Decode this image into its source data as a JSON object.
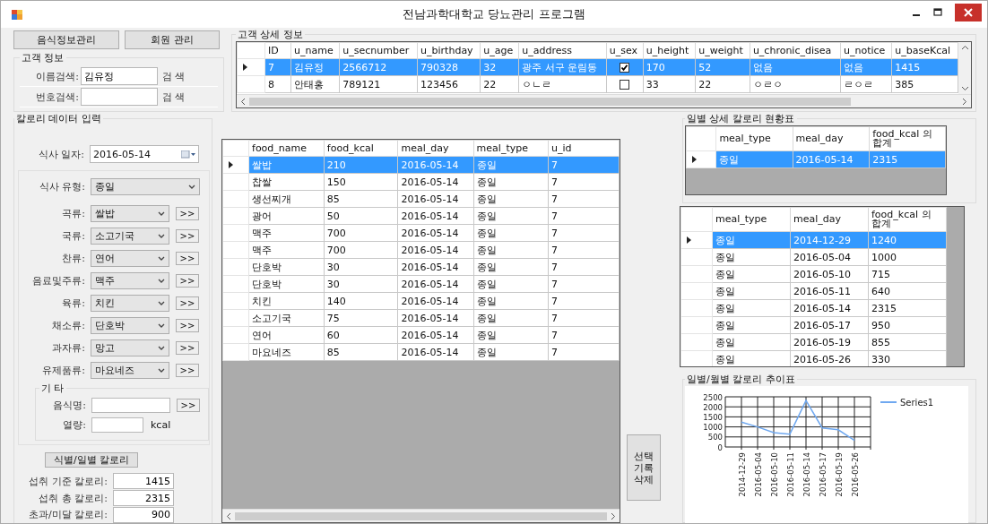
{
  "window": {
    "title": "전남과학대학교 당뇨관리 프로그램"
  },
  "top_buttons": [
    "음식정보관리",
    "회원 관리"
  ],
  "customer_info": {
    "title": "고객 정보",
    "searches": [
      {
        "label": "이름검색:",
        "value": "김유정",
        "button": "검 색"
      },
      {
        "label": "번호검색:",
        "button": "검 색"
      }
    ]
  },
  "customer_detail": {
    "title": "고객 상세 정보",
    "columns": [
      "ID",
      "u_name",
      "u_secnumber",
      "u_birthday",
      "u_age",
      "u_address",
      "u_sex",
      "u_height",
      "u_weight",
      "u_chronic_disea",
      "u_notice",
      "u_baseKcal"
    ],
    "rows": [
      {
        "selected": true,
        "cells": [
          "7",
          "김유정",
          "2566712",
          "790328",
          "32",
          "광주 서구 운림동",
          {
            "checked": true
          },
          "170",
          "52",
          "없음",
          "없음",
          "1415"
        ]
      },
      {
        "selected": false,
        "cells": [
          "8",
          "안태홍",
          "789121",
          "123456",
          "22",
          "ㅇㄴㄹ",
          {
            "checked": false
          },
          "33",
          "22",
          "ㅇㄹㅇ",
          "ㄹㅇㄹ",
          "385"
        ]
      }
    ]
  },
  "calorie_input": {
    "title": "칼로리 데이터 입력",
    "date": {
      "label": "식사 일자:",
      "value": "2016-05-14"
    },
    "meal_type": {
      "label": "식사 유형:",
      "value": "종일"
    },
    "categories": [
      {
        "label": "곡류:",
        "value": "쌀밥",
        "button": ">>"
      },
      {
        "label": "국류:",
        "value": "소고기국",
        "button": ">>"
      },
      {
        "label": "찬류:",
        "value": "연어",
        "button": ">>"
      },
      {
        "label": "음료및주류:",
        "value": "맥주",
        "button": ">>"
      },
      {
        "label": "육류:",
        "value": "치킨",
        "button": ">>"
      },
      {
        "label": "채소류:",
        "value": "단호박",
        "button": ">>"
      },
      {
        "label": "과자류:",
        "value": "망고",
        "button": ">>"
      },
      {
        "label": "유제품류:",
        "value": "마요네즈",
        "button": ">>"
      }
    ],
    "other": {
      "title": "기 타",
      "name_label": "음식명:",
      "name_button": ">>",
      "kcal_label": "열량:",
      "unit": "kcal"
    },
    "calc_button": "식별/일별 칼로리",
    "summary": [
      {
        "label": "섭취 기준 칼로리:",
        "value": "1415"
      },
      {
        "label": "섭취 총 칼로리:",
        "value": "2315"
      },
      {
        "label": "초과/미달 칼로리:",
        "value": "900"
      }
    ]
  },
  "food_table": {
    "columns": [
      "food_name",
      "food_kcal",
      "meal_day",
      "meal_type",
      "u_id"
    ],
    "rows": [
      {
        "selected": true,
        "cells": [
          "쌀밥",
          "210",
          "2016-05-14",
          "종일",
          "7"
        ]
      },
      {
        "selected": false,
        "cells": [
          "찹쌀",
          "150",
          "2016-05-14",
          "종일",
          "7"
        ]
      },
      {
        "selected": false,
        "cells": [
          "생선찌개",
          "85",
          "2016-05-14",
          "종일",
          "7"
        ]
      },
      {
        "selected": false,
        "cells": [
          "광어",
          "50",
          "2016-05-14",
          "종일",
          "7"
        ]
      },
      {
        "selected": false,
        "cells": [
          "맥주",
          "700",
          "2016-05-14",
          "종일",
          "7"
        ]
      },
      {
        "selected": false,
        "cells": [
          "맥주",
          "700",
          "2016-05-14",
          "종일",
          "7"
        ]
      },
      {
        "selected": false,
        "cells": [
          "단호박",
          "30",
          "2016-05-14",
          "종일",
          "7"
        ]
      },
      {
        "selected": false,
        "cells": [
          "단호박",
          "30",
          "2016-05-14",
          "종일",
          "7"
        ]
      },
      {
        "selected": false,
        "cells": [
          "치킨",
          "140",
          "2016-05-14",
          "종일",
          "7"
        ]
      },
      {
        "selected": false,
        "cells": [
          "소고기국",
          "75",
          "2016-05-14",
          "종일",
          "7"
        ]
      },
      {
        "selected": false,
        "cells": [
          "연어",
          "60",
          "2016-05-14",
          "종일",
          "7"
        ]
      },
      {
        "selected": false,
        "cells": [
          "마요네즈",
          "85",
          "2016-05-14",
          "종일",
          "7"
        ]
      }
    ]
  },
  "delete_button": "선택 기록 삭제",
  "daily_detail": {
    "title": "일별 상세 칼로리 현황표",
    "columns": [
      "meal_type",
      "meal_day",
      "food_kcal 의 합계"
    ],
    "rows": [
      {
        "selected": true,
        "cells": [
          "종일",
          "2016-05-14",
          "2315"
        ]
      }
    ]
  },
  "daily_totals": {
    "columns": [
      "meal_type",
      "meal_day",
      "food_kcal 의 합계"
    ],
    "rows": [
      {
        "selected": true,
        "cells": [
          "종일",
          "2014-12-29",
          "1240"
        ]
      },
      {
        "selected": false,
        "cells": [
          "종일",
          "2016-05-04",
          "1000"
        ]
      },
      {
        "selected": false,
        "cells": [
          "종일",
          "2016-05-10",
          "715"
        ]
      },
      {
        "selected": false,
        "cells": [
          "종일",
          "2016-05-11",
          "640"
        ]
      },
      {
        "selected": false,
        "cells": [
          "종일",
          "2016-05-14",
          "2315"
        ]
      },
      {
        "selected": false,
        "cells": [
          "종일",
          "2016-05-17",
          "950"
        ]
      },
      {
        "selected": false,
        "cells": [
          "종일",
          "2016-05-19",
          "855"
        ]
      },
      {
        "selected": false,
        "cells": [
          "종일",
          "2016-05-26",
          "330"
        ]
      }
    ]
  },
  "trend": {
    "title": "일별/월별 칼로리 추이표",
    "chart_data": {
      "type": "line",
      "categories": [
        "2014-12-29",
        "2016-05-04",
        "2016-05-10",
        "2016-05-11",
        "2016-05-14",
        "2016-05-17",
        "2016-05-19",
        "2016-05-26"
      ],
      "series": [
        {
          "name": "Series1",
          "color": "#6fa8f0",
          "values": [
            1240,
            1000,
            715,
            640,
            2315,
            950,
            855,
            330
          ]
        }
      ],
      "grid": true,
      "ylim": [
        0,
        2500
      ],
      "yticks": [
        0,
        500,
        1000,
        1500,
        2000,
        2500
      ]
    }
  }
}
